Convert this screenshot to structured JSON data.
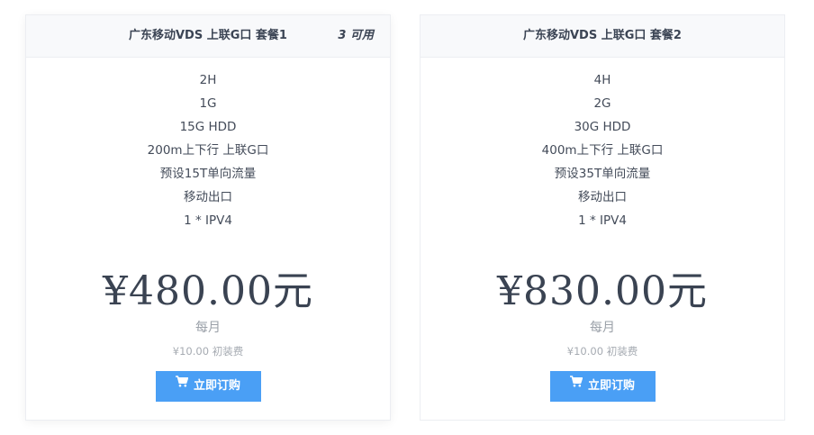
{
  "packages": [
    {
      "title": "广东移动VDS 上联G口 套餐1",
      "availability": "3 可用",
      "features": [
        "2H",
        "1G",
        "15G HDD",
        "200m上下行 上联G口",
        "预设15T单向流量",
        "移动出口",
        "1 * IPV4"
      ],
      "price": "¥480.00元",
      "period": "每月",
      "setup_fee": "¥10.00 初装费",
      "order_label": "立即订购",
      "order_icon": "cart-icon"
    },
    {
      "title": "广东移动VDS 上联G口 套餐2",
      "features": [
        "4H",
        "2G",
        "30G HDD",
        "400m上下行 上联G口",
        "预设35T单向流量",
        "移动出口",
        "1 * IPV4"
      ],
      "price": "¥830.00元",
      "period": "每月",
      "setup_fee": "¥10.00 初装费",
      "order_label": "立即订购",
      "order_icon": "cart-icon"
    }
  ],
  "colors": {
    "button": "#4a9ff5",
    "header_bg": "#f8f9fb",
    "price_text": "#3a4352",
    "muted_text": "#9aa0a8"
  }
}
